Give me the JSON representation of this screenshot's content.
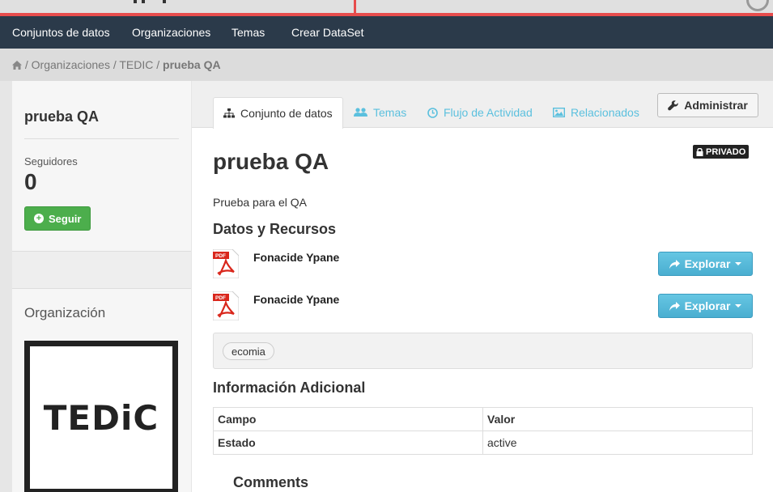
{
  "nav": {
    "items": [
      "Conjuntos de datos",
      "Organizaciones",
      "Temas",
      "Crear DataSet"
    ]
  },
  "breadcrumb": {
    "separator": "/",
    "items": [
      "Organizaciones",
      "TEDIC"
    ],
    "current": "prueba QA"
  },
  "sidebar": {
    "title": "prueba QA",
    "followers_label": "Seguidores",
    "followers_count": "0",
    "follow_label": "Seguir",
    "org_heading": "Organización",
    "org_logo_text": "TEDiC"
  },
  "tabs": {
    "dataset": "Conjunto de datos",
    "groups": "Temas",
    "activity": "Flujo de Actividad",
    "related": "Relacionados",
    "admin": "Administrar"
  },
  "dataset": {
    "private_badge": "PRIVADO",
    "title": "prueba QA",
    "description": "Prueba para el QA",
    "resources_heading": "Datos y Recursos",
    "resources": [
      {
        "format": "PDF",
        "name": "Fonacide Ypane",
        "action": "Explorar"
      },
      {
        "format": "PDF",
        "name": "Fonacide Ypane",
        "action": "Explorar"
      }
    ],
    "tags": [
      "ecomia"
    ],
    "additional_heading": "Información Adicional",
    "table": {
      "headers": [
        "Campo",
        "Valor"
      ],
      "rows": [
        [
          "Estado",
          "active"
        ]
      ]
    },
    "comments_heading": "Comments"
  },
  "colors": {
    "navbar": "#2b3a4a",
    "accent_red": "#e74c4c",
    "follow_green": "#4cae4c",
    "explore_blue": "#5bc0de"
  },
  "icons": {
    "breadcrumb_home": "home-icon",
    "tab_dataset": "sitemap-icon",
    "tab_groups": "users-icon",
    "tab_activity": "clock-icon",
    "tab_related": "picture-icon",
    "admin": "wrench-icon",
    "private": "lock-icon",
    "follow": "plus-circle-icon",
    "explore": "share-arrow-icon",
    "resource": "pdf-file-icon"
  }
}
